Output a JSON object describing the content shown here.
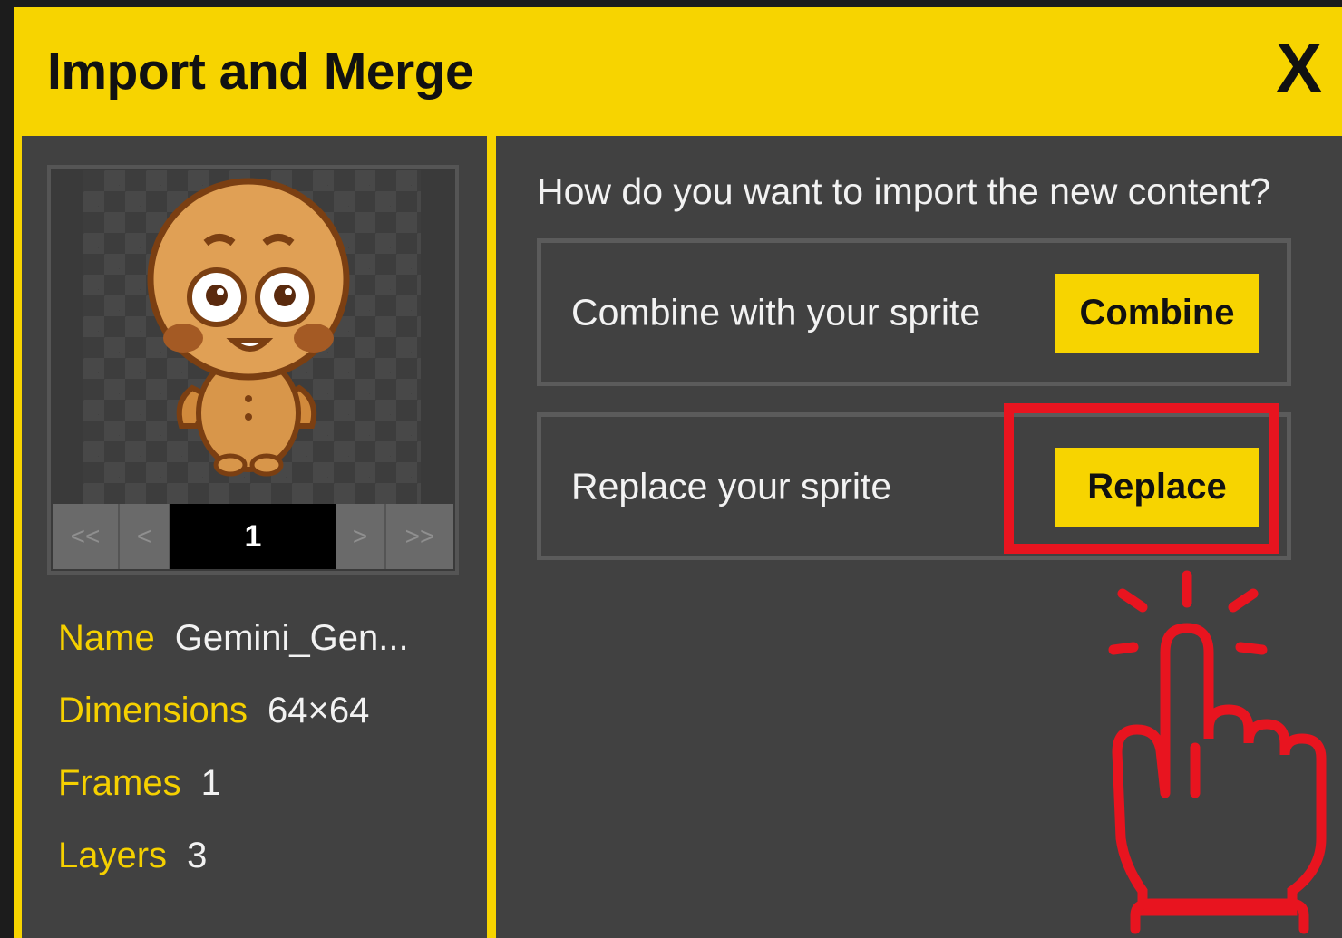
{
  "dialog": {
    "title": "Import and Merge",
    "close_label": "X"
  },
  "preview": {
    "nav_first": "<<",
    "nav_prev": "<",
    "frame_number": "1",
    "nav_next": ">",
    "nav_last": ">>"
  },
  "info": {
    "name_label": "Name",
    "name_value": "Gemini_Gen...",
    "dimensions_label": "Dimensions",
    "dimensions_value": "64×64",
    "frames_label": "Frames",
    "frames_value": "1",
    "layers_label": "Layers",
    "layers_value": "3"
  },
  "import": {
    "question": "How do you want to import the new content?",
    "combine_text": "Combine with your sprite",
    "combine_button": "Combine",
    "replace_text": "Replace your sprite",
    "replace_button": "Replace"
  },
  "colors": {
    "accent": "#f7d400",
    "panel": "#414141",
    "highlight": "#e8141f"
  },
  "icons": {
    "close": "close-icon",
    "pointer": "pointing-hand-icon",
    "sprite": "gingerbread-sprite"
  }
}
